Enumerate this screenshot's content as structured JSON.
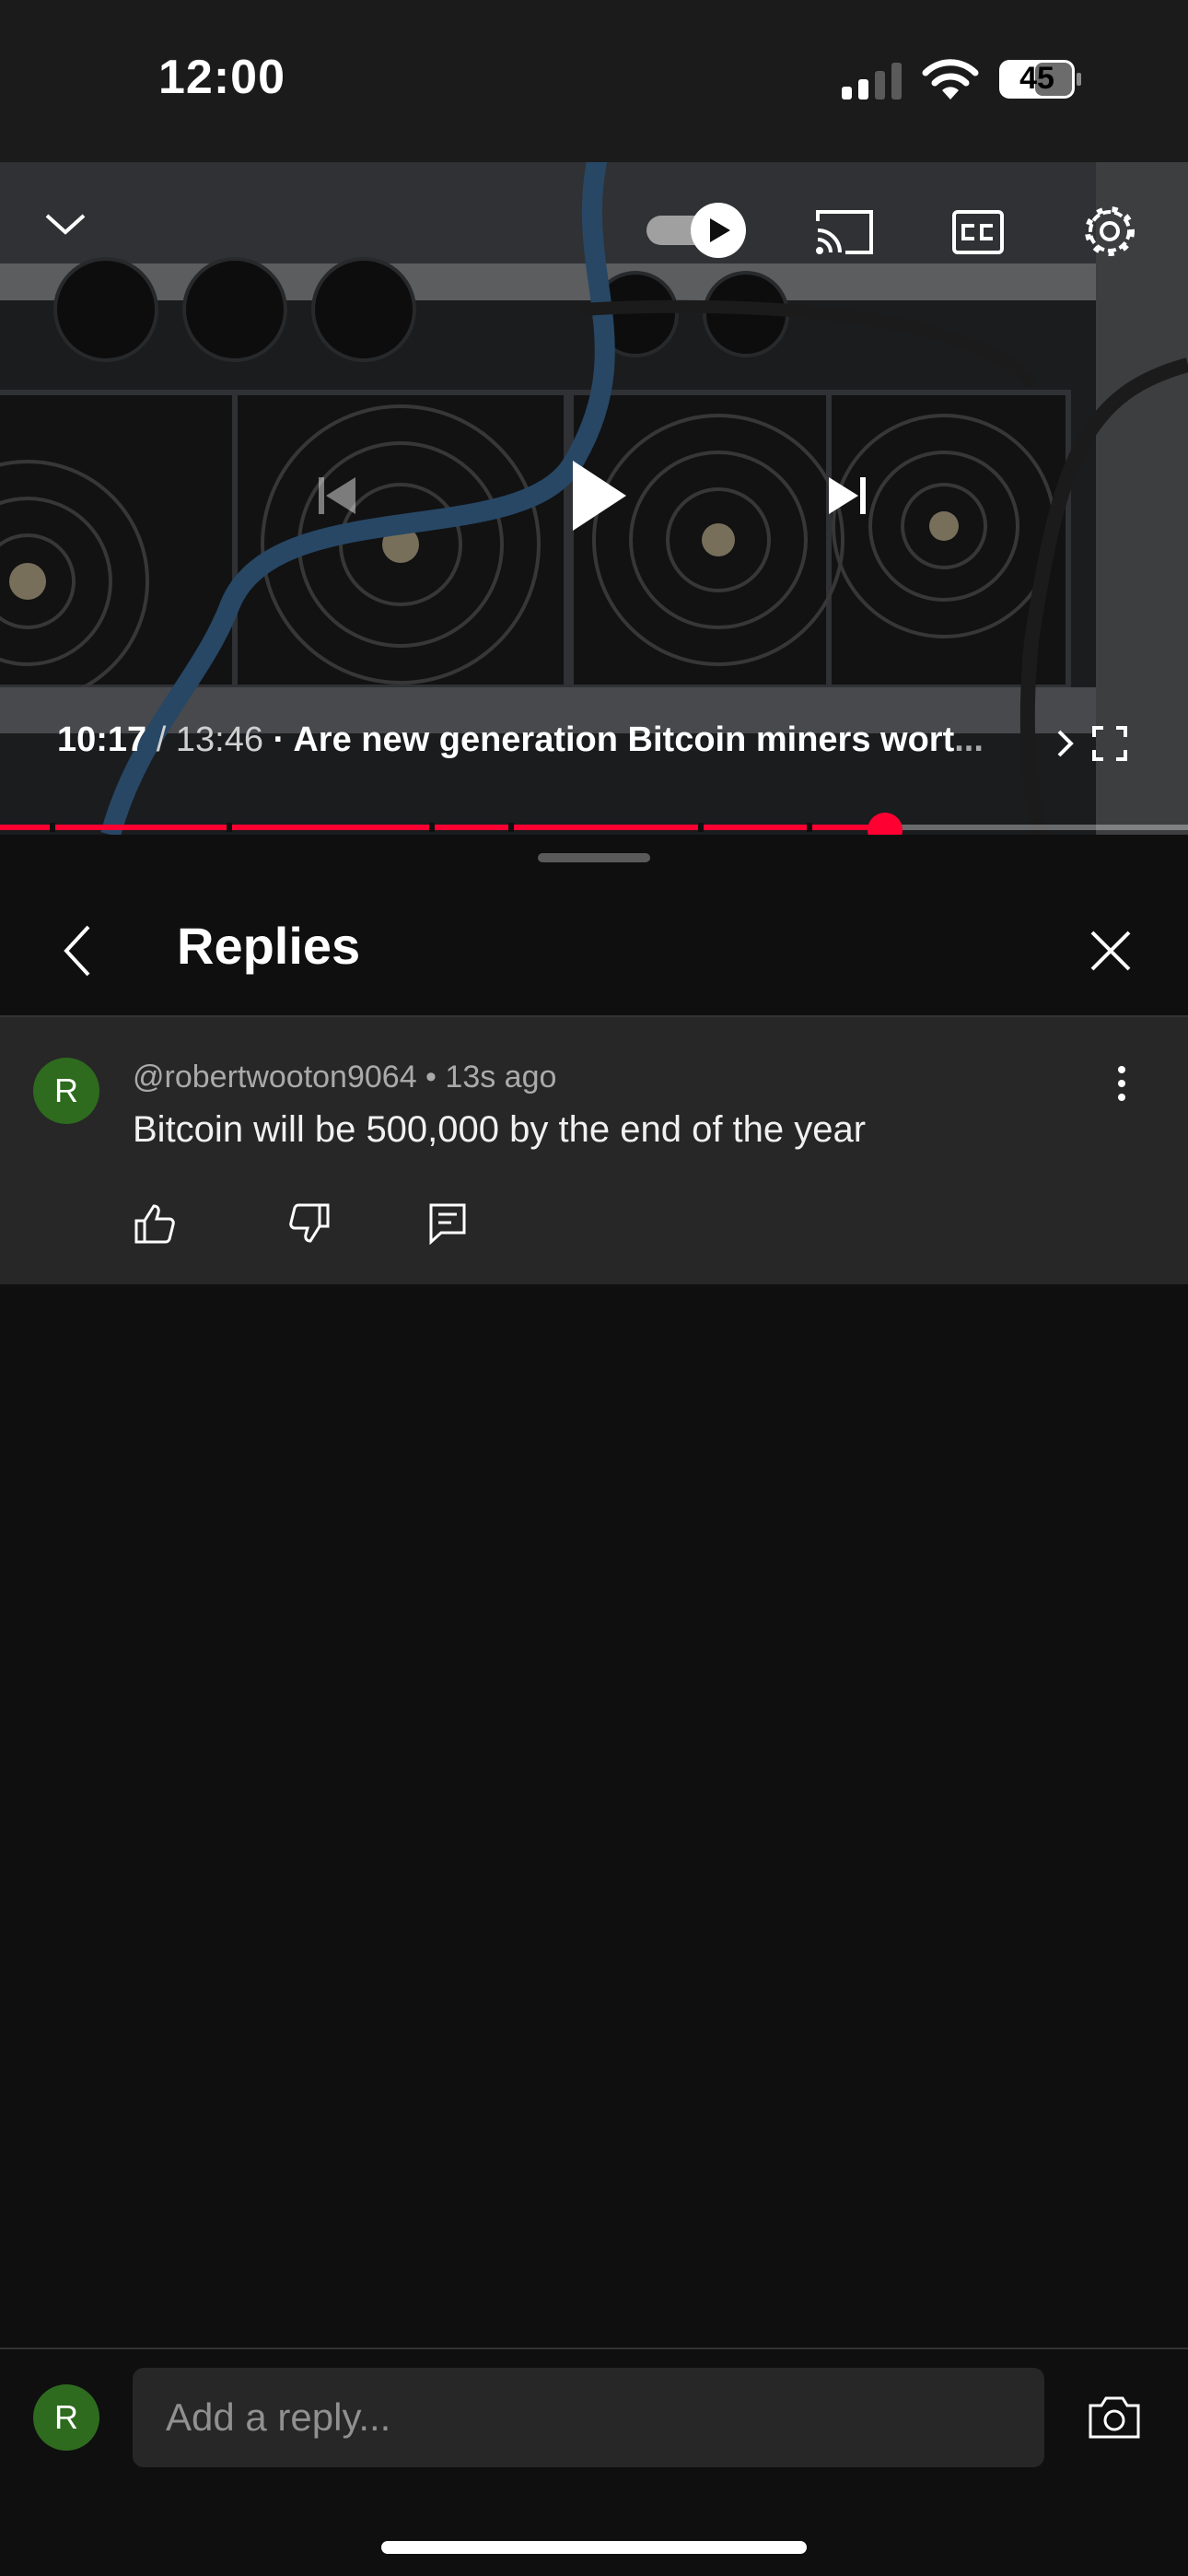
{
  "status_bar": {
    "time": "12:00",
    "battery": "45",
    "icons": [
      "signal-icon",
      "wifi-icon",
      "battery-icon"
    ]
  },
  "player": {
    "current_time": "10:17",
    "duration": "13:46",
    "separator": " / ",
    "dot": " · ",
    "title": "Are new generation Bitcoin miners wort",
    "title_truncated": "...",
    "progress_fraction": 0.745,
    "autoplay_on": true,
    "icons": [
      "collapse-chevron-icon",
      "autoplay-toggle-icon",
      "cast-icon",
      "captions-icon",
      "settings-icon",
      "previous-icon",
      "play-icon",
      "next-icon",
      "chapter-chevron-icon",
      "fullscreen-icon"
    ]
  },
  "sheet": {
    "title": "Replies"
  },
  "comment": {
    "avatar_letter": "R",
    "author": "@robertwooton9064",
    "meta_dot": " • ",
    "time_ago": "13s ago",
    "text": "Bitcoin will be 500,000 by the end of the year"
  },
  "reply_bar": {
    "avatar_letter": "R",
    "placeholder": "Add a reply..."
  },
  "colors": {
    "accent": "#ff0033",
    "avatar_bg": "#2e6b1e",
    "comment_bg": "#272727",
    "background": "#0f0f0f"
  }
}
